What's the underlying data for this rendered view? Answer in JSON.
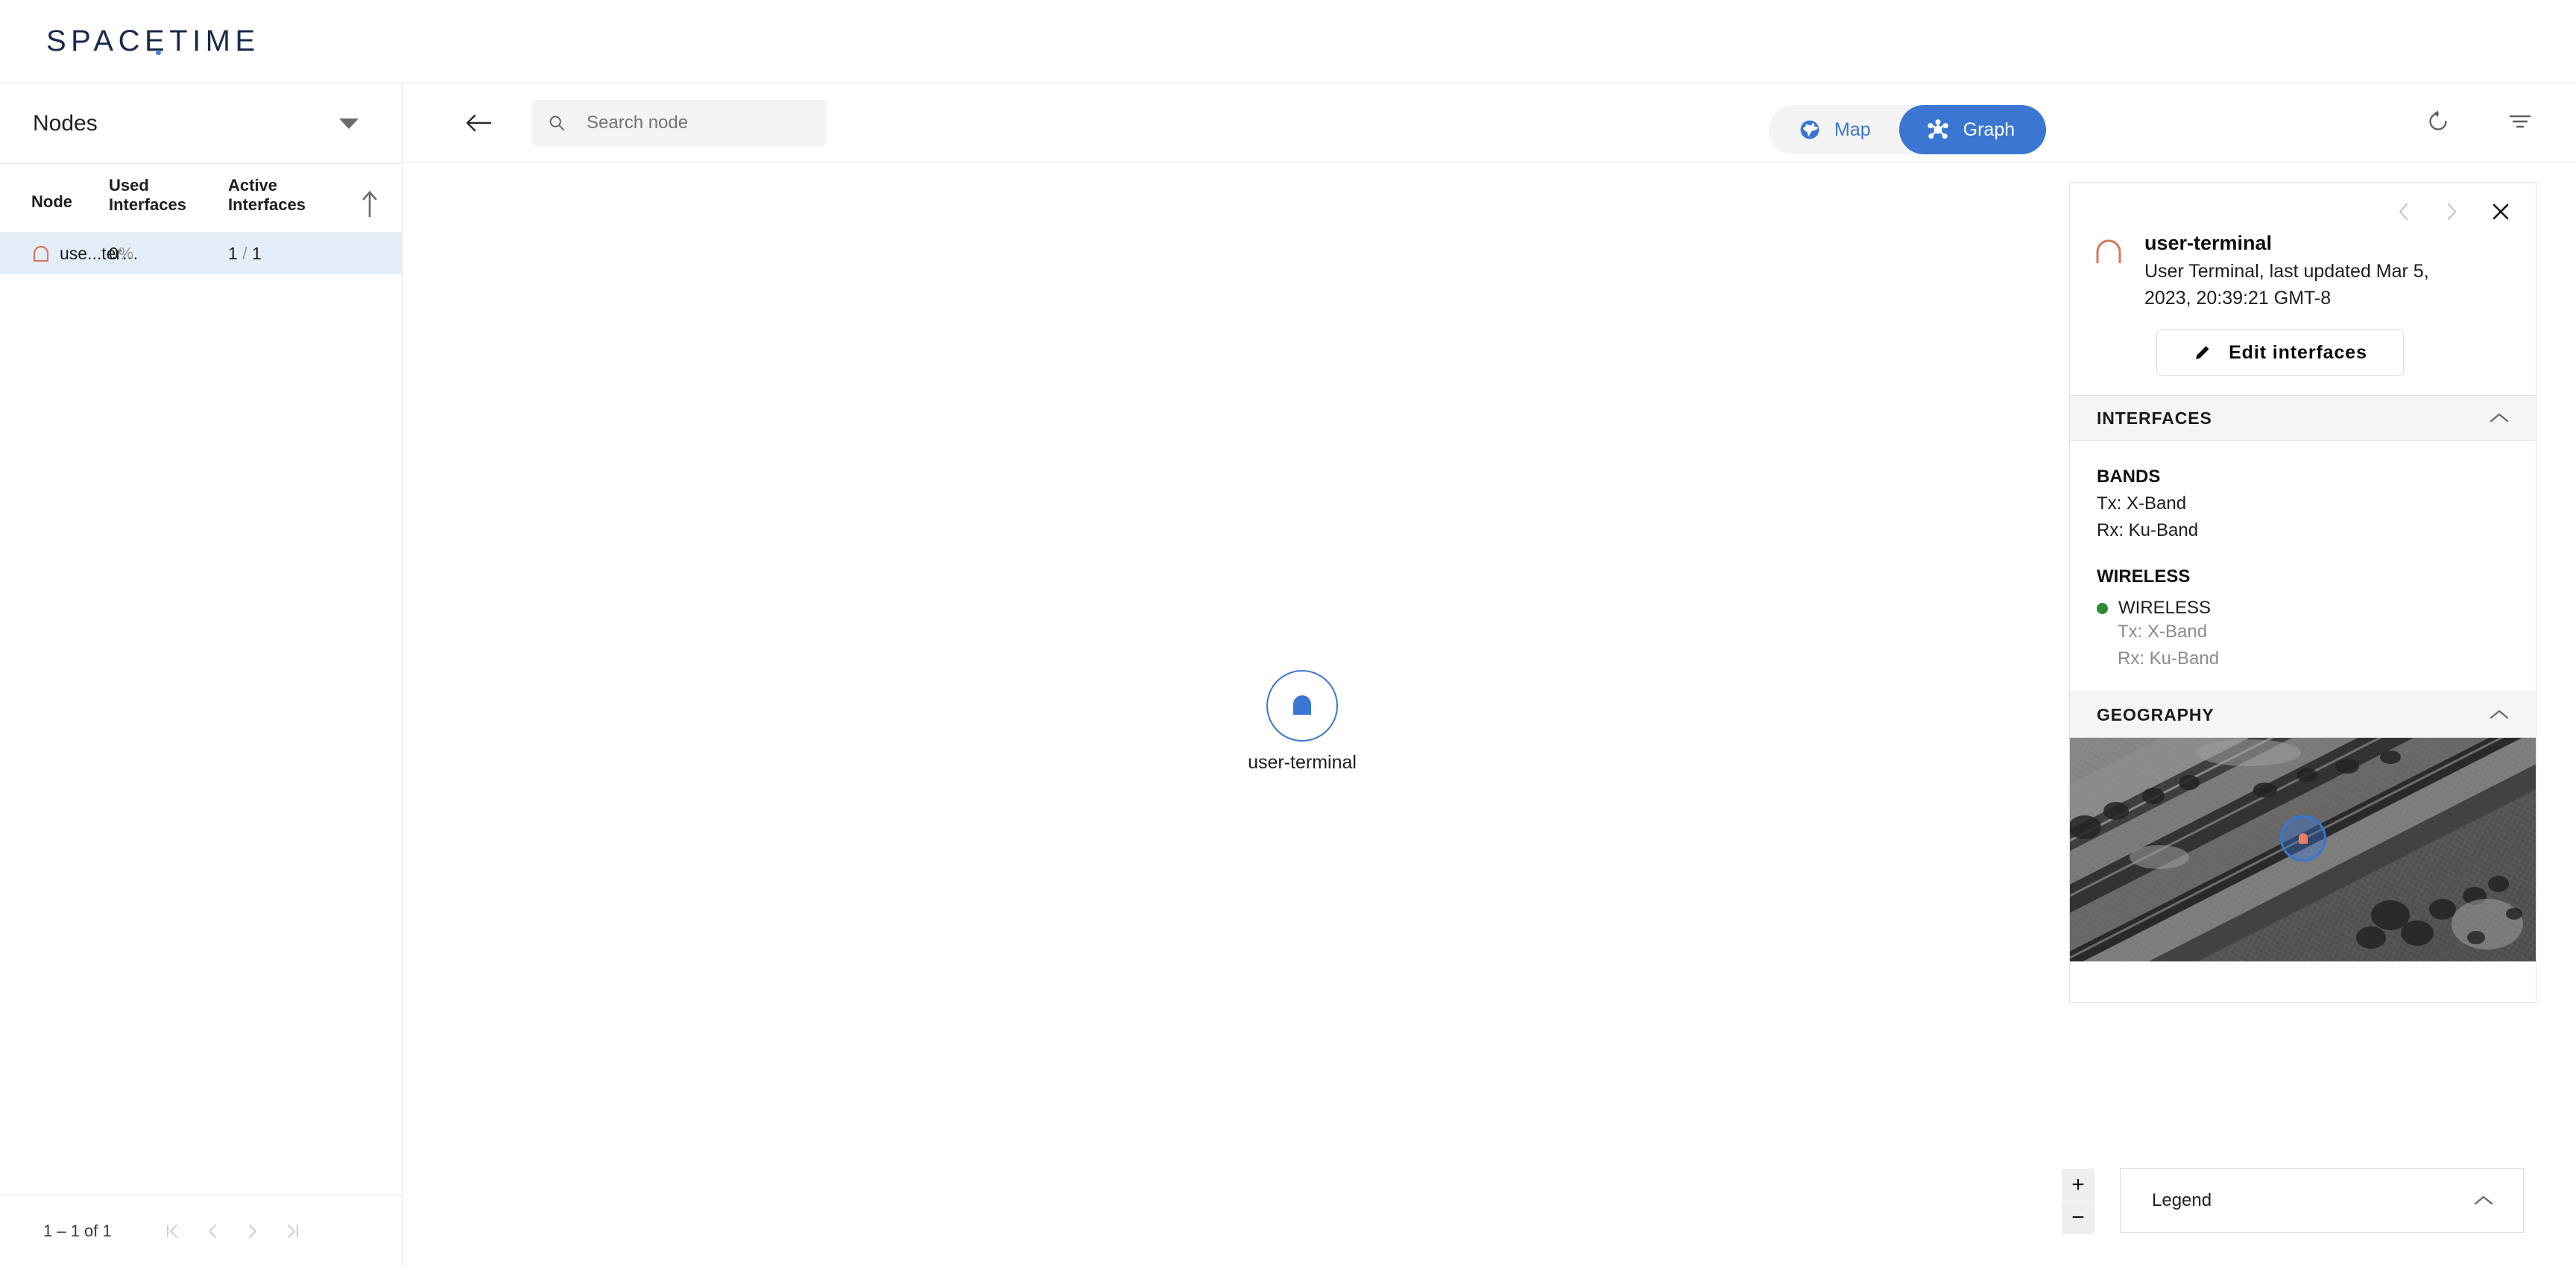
{
  "app": {
    "brand": "SPACETIME",
    "accent_blue": "#3a76d2",
    "node_orange": "#d9775c",
    "status_green": "#2e8b33",
    "row_highlight": "#e3eef9"
  },
  "sidebar": {
    "title": "Nodes",
    "caret_icon": "chevron-down-icon",
    "columns": [
      "Node",
      "Used Interfaces",
      "Active Interfaces"
    ],
    "sort_icon": "sort-ascending-arrow-icon",
    "rows": [
      {
        "icon": "terminal-dome-icon",
        "node": "use...ter…",
        "used_interfaces": "0",
        "used_interfaces_unit": "%",
        "active_numerator": "1",
        "active_separator": "/",
        "active_denominator": "1"
      }
    ],
    "footer": {
      "range_label": "1 – 1 of 1",
      "first_page_icon": "first-page-icon",
      "prev_page_icon": "previous-page-icon",
      "next_page_icon": "next-page-icon",
      "last_page_icon": "last-page-icon"
    }
  },
  "toolbar": {
    "back_icon": "back-arrow-icon",
    "search": {
      "icon": "search-icon",
      "placeholder": "Search node",
      "value": ""
    },
    "views": [
      {
        "label": "Map",
        "icon": "globe-icon",
        "active": false
      },
      {
        "label": "Graph",
        "icon": "graph-hub-icon",
        "active": true
      }
    ],
    "refresh_icon": "refresh-rotate-icon",
    "filter_icon": "filter-icon"
  },
  "canvas": {
    "node": {
      "label": "user-terminal",
      "icon": "terminal-dome-icon"
    },
    "zoom_in_label": "+",
    "zoom_out_label": "−",
    "legend": {
      "label": "Legend",
      "collapse_icon": "chevron-up-icon"
    }
  },
  "detail": {
    "prev_icon": "chevron-left-icon",
    "next_icon": "chevron-right-icon",
    "close_icon": "close-icon",
    "node_icon": "terminal-dome-icon",
    "name": "user-terminal",
    "subtitle": "User Terminal, last updated Mar 5, 2023, 20:39:21 GMT-8",
    "edit_button": {
      "label": "Edit interfaces",
      "icon": "pencil-icon"
    },
    "sections": [
      {
        "title": "INTERFACES",
        "collapse_icon": "chevron-up-icon",
        "bands_title": "BANDS",
        "bands": [
          "Tx: X-Band",
          "Rx: Ku-Band"
        ],
        "wireless_title": "WIRELESS",
        "interfaces": [
          {
            "status": "up",
            "name": "WIRELESS",
            "details": [
              "Tx: X-Band",
              "Rx: Ku-Band"
            ]
          }
        ]
      },
      {
        "title": "GEOGRAPHY",
        "collapse_icon": "chevron-up-icon",
        "map_marker_icon": "terminal-dome-icon"
      }
    ]
  }
}
